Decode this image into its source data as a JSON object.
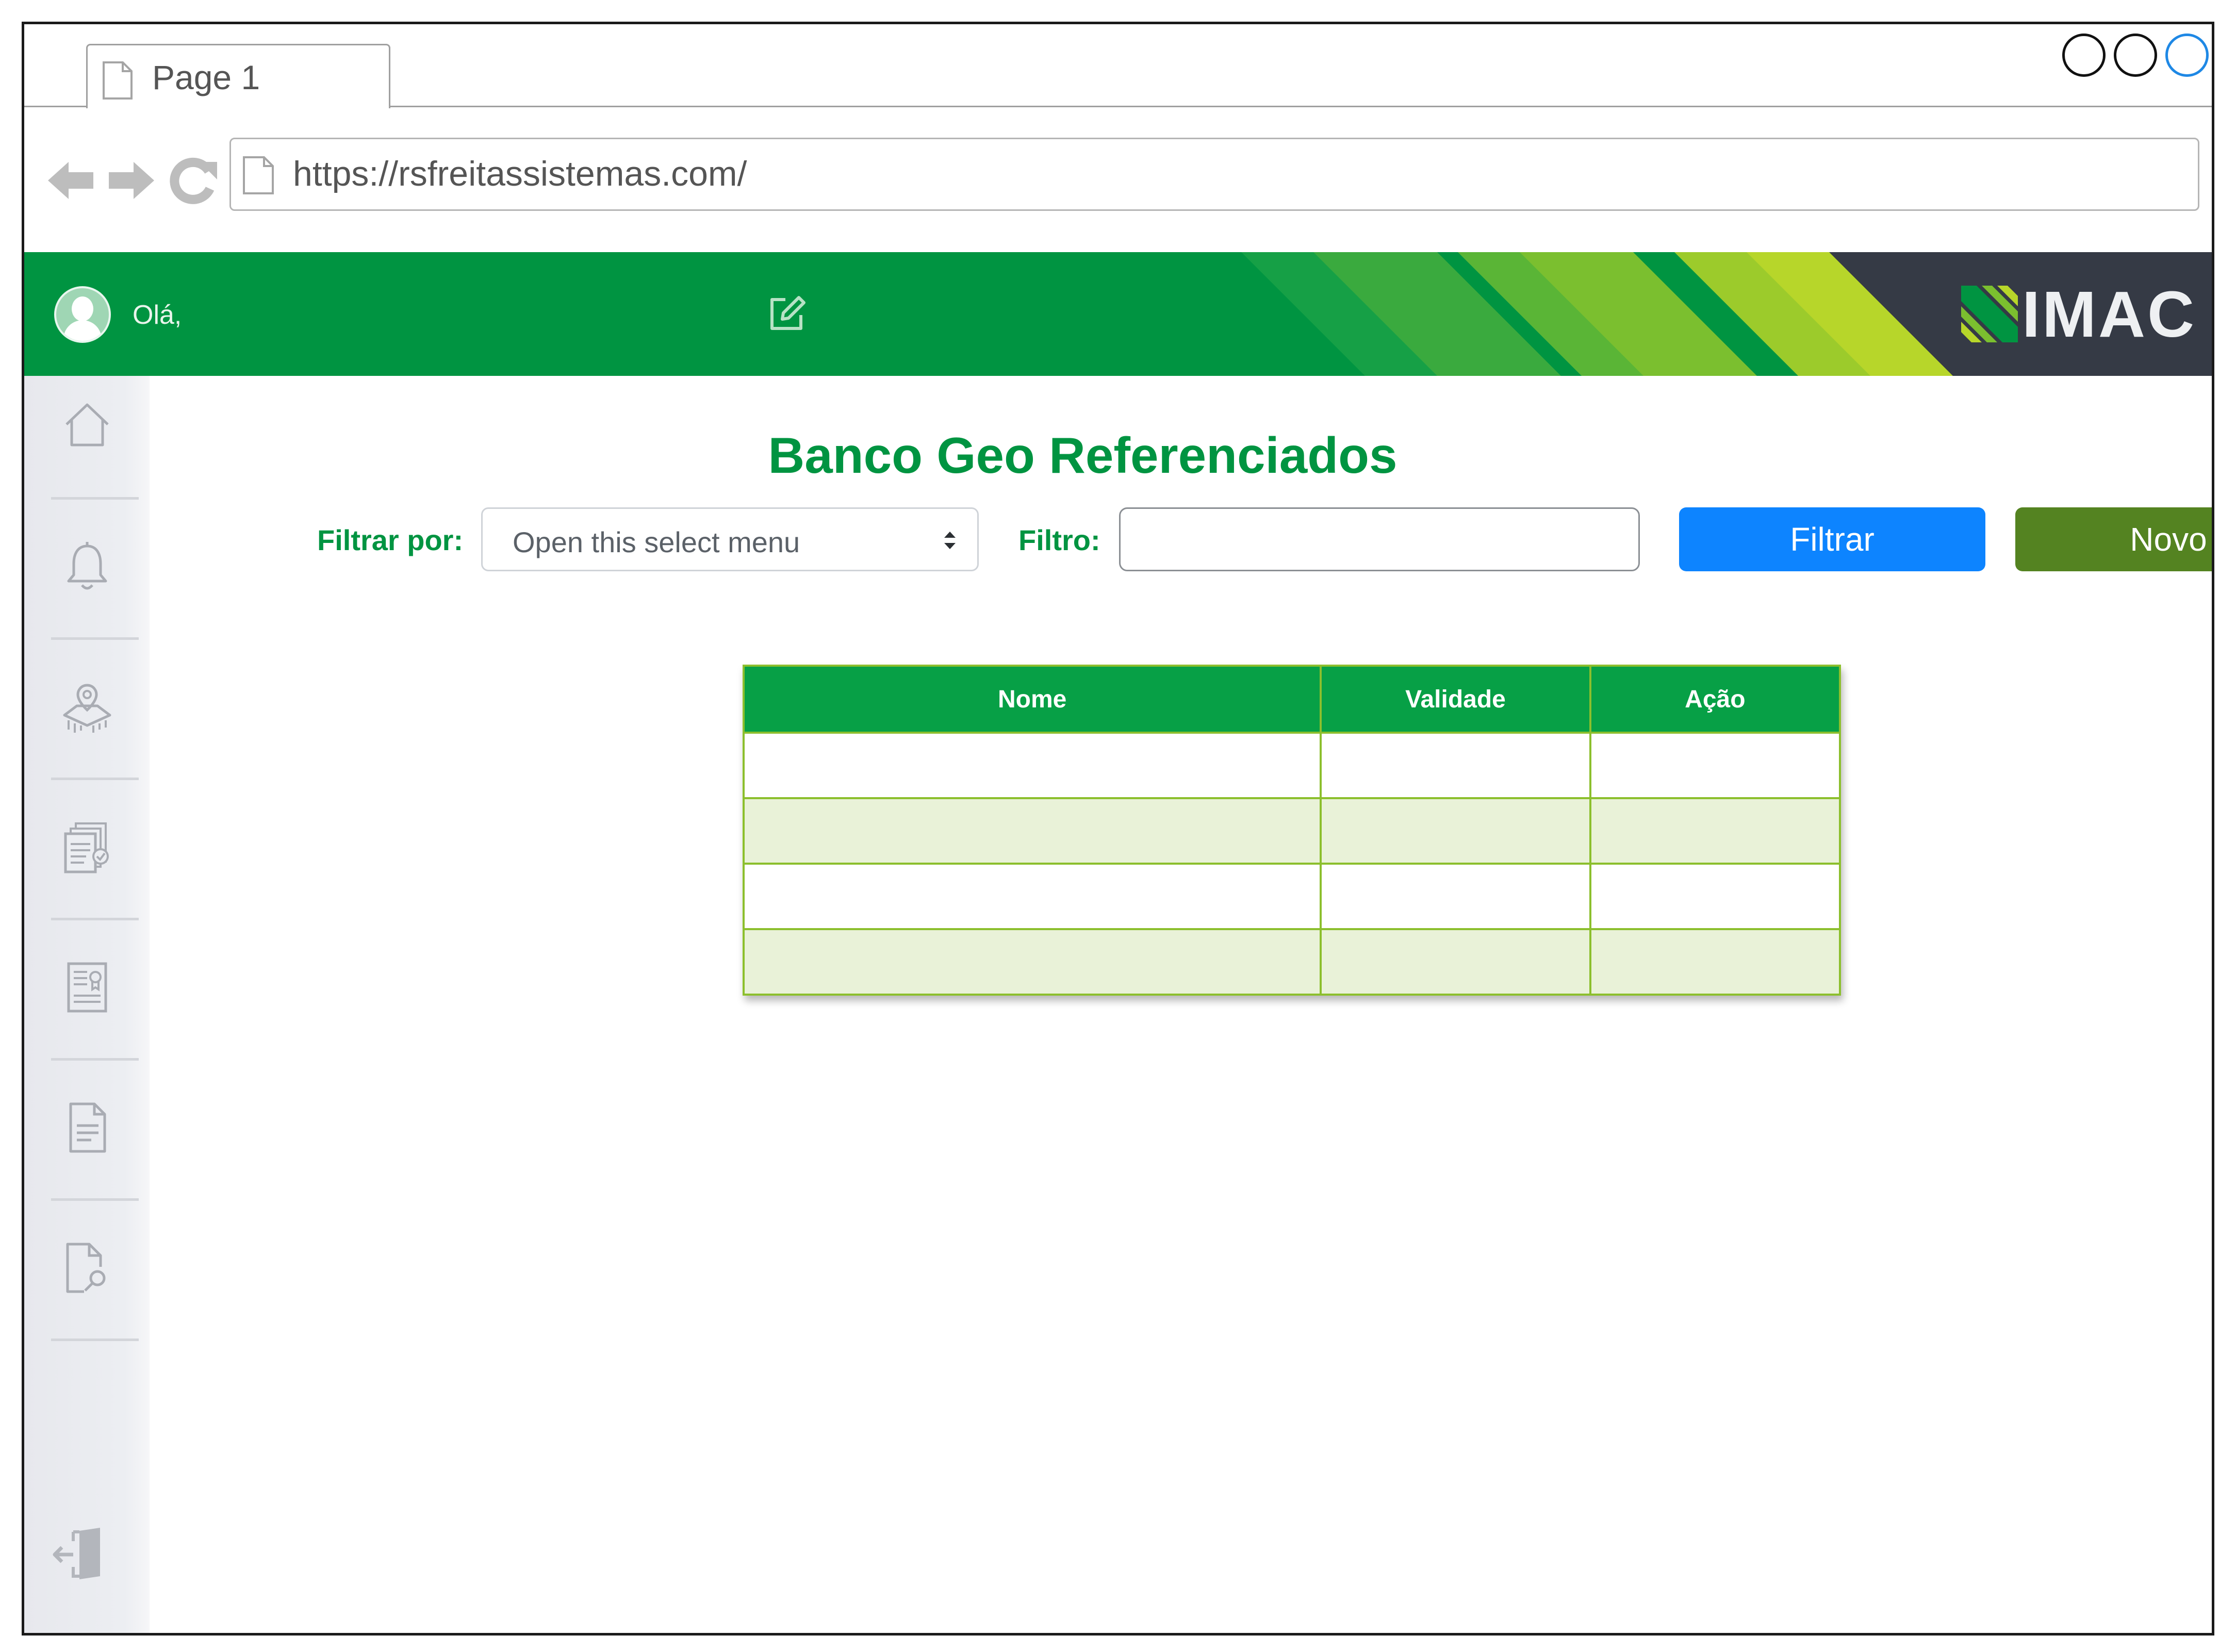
{
  "browser": {
    "tab_title": "Page 1",
    "url": "https://rsfreitassistemas.com/"
  },
  "header": {
    "greeting": "Olá,",
    "logo_text": "IMAC"
  },
  "sidebar": {
    "items": [
      {
        "icon": "home-icon"
      },
      {
        "icon": "bell-icon"
      },
      {
        "icon": "map-pin-icon"
      },
      {
        "icon": "documents-check-icon"
      },
      {
        "icon": "certificate-icon"
      },
      {
        "icon": "document-text-icon"
      },
      {
        "icon": "document-search-icon"
      }
    ],
    "exit_icon": "logout-icon"
  },
  "main": {
    "title": "Banco Geo Referenciados",
    "filter_by_label": "Filtrar por:",
    "select_placeholder": "Open this select menu",
    "filter_label": "Filtro:",
    "filter_value": "",
    "filter_button": "Filtrar",
    "new_button": "Novo"
  },
  "table": {
    "columns": [
      "Nome",
      "Validade",
      "Ação"
    ],
    "rows": [
      [
        "",
        "",
        ""
      ],
      [
        "",
        "",
        ""
      ],
      [
        "",
        "",
        ""
      ],
      [
        "",
        "",
        ""
      ]
    ]
  },
  "colors": {
    "brand_green": "#009441",
    "filter_button": "#0d84ff",
    "new_button": "#548321",
    "table_header": "#07a046",
    "table_border": "#8cbf2d",
    "table_alt_row": "#e9f2d8"
  }
}
